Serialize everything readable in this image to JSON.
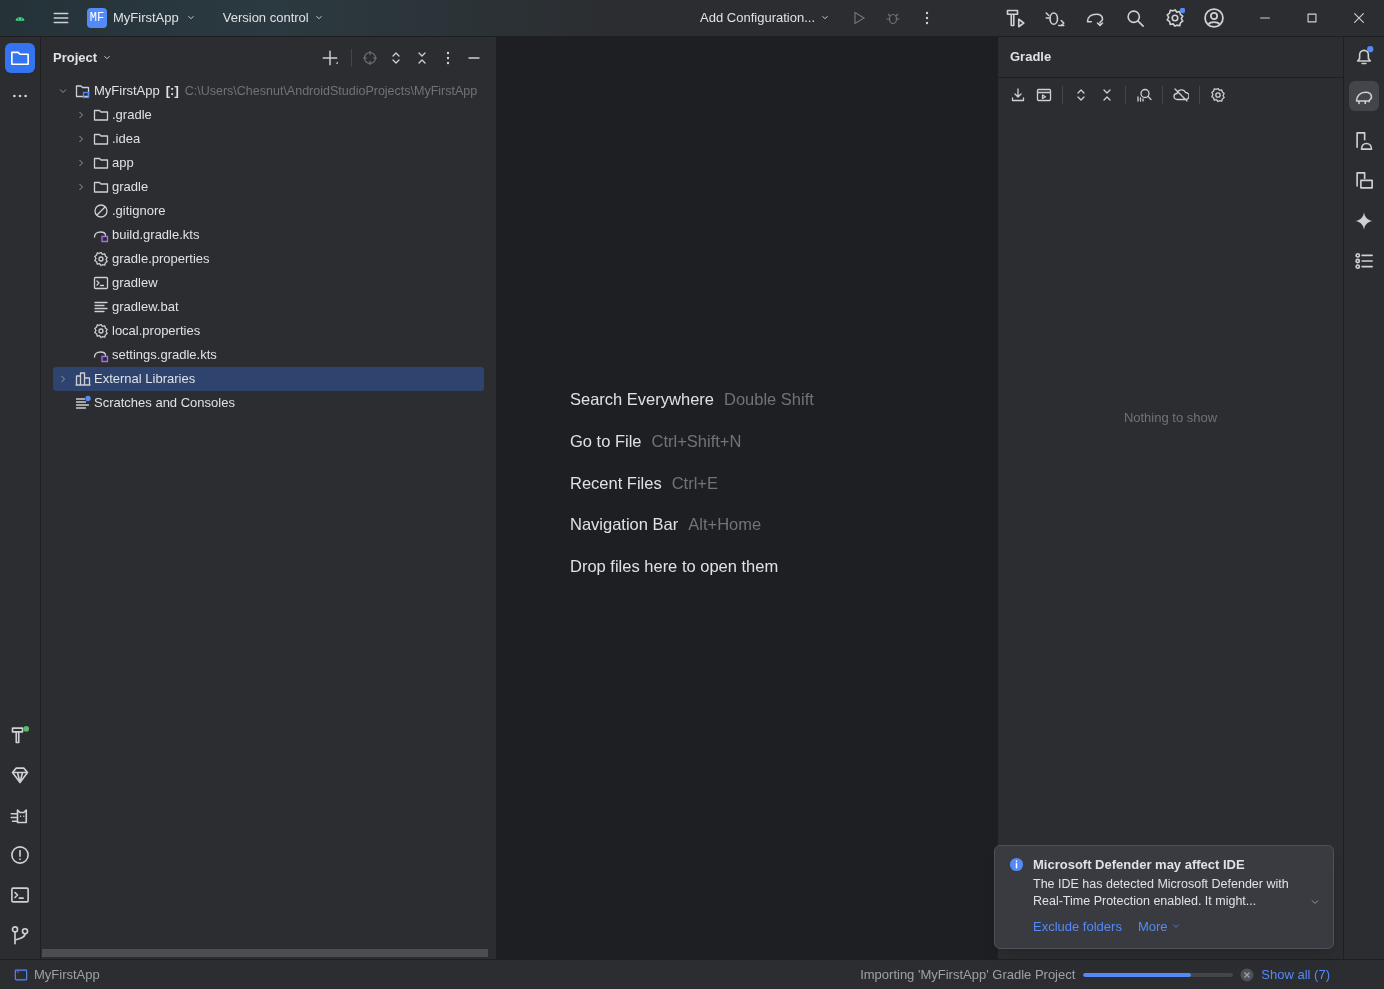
{
  "title_bar": {
    "project_badge": "MF",
    "project": "MyFirstApp",
    "vcs": "Version control",
    "run_config": "Add Configuration..."
  },
  "project_panel": {
    "title": "Project",
    "tree": [
      {
        "name": "MyFirstApp",
        "tag": "[:]",
        "path": "C:\\Users\\Chesnut\\AndroidStudioProjects\\MyFirstApp",
        "kind": "module",
        "expanded": true,
        "selected": false,
        "children": [
          {
            "name": ".gradle",
            "kind": "folder",
            "expanded": false,
            "selected": false
          },
          {
            "name": ".idea",
            "kind": "folder",
            "expanded": false,
            "selected": false
          },
          {
            "name": "app",
            "kind": "folder",
            "expanded": false,
            "selected": false
          },
          {
            "name": "gradle",
            "kind": "folder",
            "expanded": false,
            "selected": false
          },
          {
            "name": ".gitignore",
            "kind": "ignore",
            "selected": false
          },
          {
            "name": "build.gradle.kts",
            "kind": "gradle-script",
            "selected": false
          },
          {
            "name": "gradle.properties",
            "kind": "properties",
            "selected": false
          },
          {
            "name": "gradlew",
            "kind": "shell",
            "selected": false
          },
          {
            "name": "gradlew.bat",
            "kind": "text",
            "selected": false
          },
          {
            "name": "local.properties",
            "kind": "properties",
            "selected": false
          },
          {
            "name": "settings.gradle.kts",
            "kind": "gradle-script",
            "selected": false
          }
        ]
      },
      {
        "name": "External Libraries",
        "kind": "libraries",
        "expanded": false,
        "selected": true
      },
      {
        "name": "Scratches and Consoles",
        "kind": "scratches",
        "selected": false
      }
    ]
  },
  "welcome_hints": [
    {
      "action": "Search Everywhere",
      "shortcut": "Double Shift"
    },
    {
      "action": "Go to File",
      "shortcut": "Ctrl+Shift+N"
    },
    {
      "action": "Recent Files",
      "shortcut": "Ctrl+E"
    },
    {
      "action": "Navigation Bar",
      "shortcut": "Alt+Home"
    },
    {
      "action": "Drop files here to open them"
    }
  ],
  "gradle_panel": {
    "title": "Gradle",
    "empty_text": "Nothing to show"
  },
  "notification": {
    "title": "Microsoft Defender may affect IDE",
    "body": "The IDE has detected Microsoft Defender with Real-Time Protection enabled. It might...",
    "actions": [
      "Exclude folders",
      "More"
    ]
  },
  "status_bar": {
    "project": "MyFirstApp",
    "task": "Importing 'MyFirstApp' Gradle Project",
    "level": 0.72,
    "link": "Show all (7)"
  }
}
